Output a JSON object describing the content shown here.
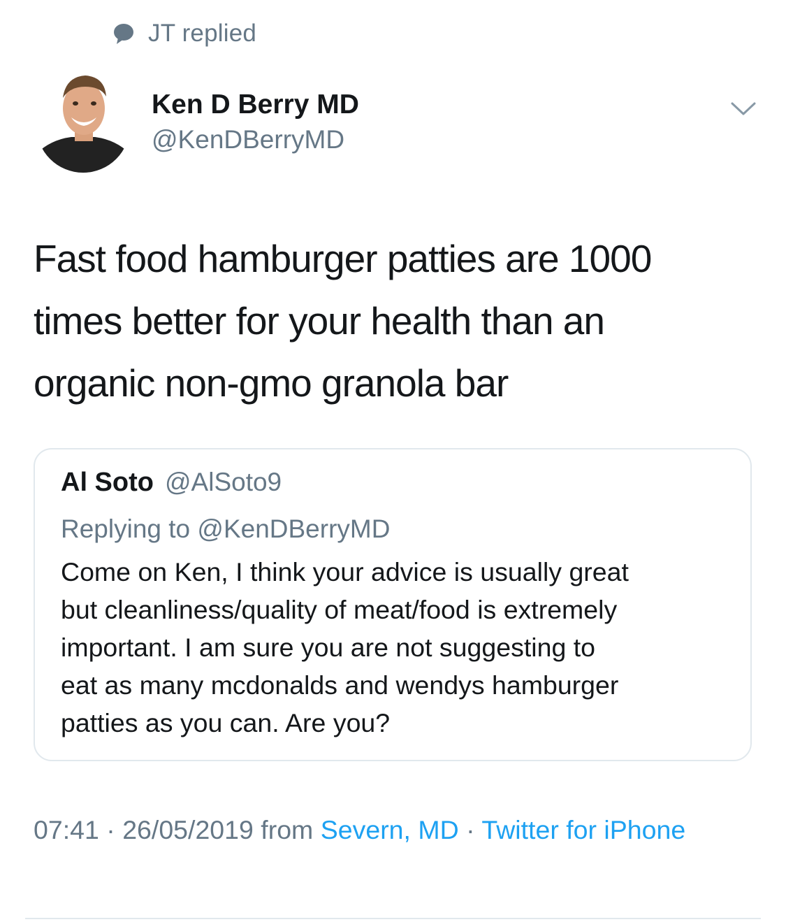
{
  "context": {
    "text": "JT replied",
    "icon": "speech-bubble-icon"
  },
  "author": {
    "name": "Ken D Berry MD",
    "handle": "@KenDBerryMD"
  },
  "menu": {
    "icon": "chevron-down-icon"
  },
  "tweet": {
    "text": "Fast food hamburger patties are 1000\ntimes better for your health than  an\norganic non-gmo granola bar"
  },
  "quote": {
    "name": "Al Soto",
    "handle": "@AlSoto9",
    "replying_to": "Replying to @KenDBerryMD",
    "text": "Come on Ken, I think your advice is usually great\nbut cleanliness/quality of meat/food is extremely\nimportant. I am sure you are not suggesting to\neat as many mcdonalds and wendys hamburger\npatties as you can. Are you?"
  },
  "meta": {
    "time": "07:41",
    "separator": "·",
    "date": "26/05/2019",
    "from_label": "from",
    "location": "Severn, MD",
    "source": "Twitter for iPhone"
  },
  "colors": {
    "text": "#14171a",
    "secondary": "#657786",
    "link": "#1da1f2",
    "border": "#e1e8ed"
  }
}
